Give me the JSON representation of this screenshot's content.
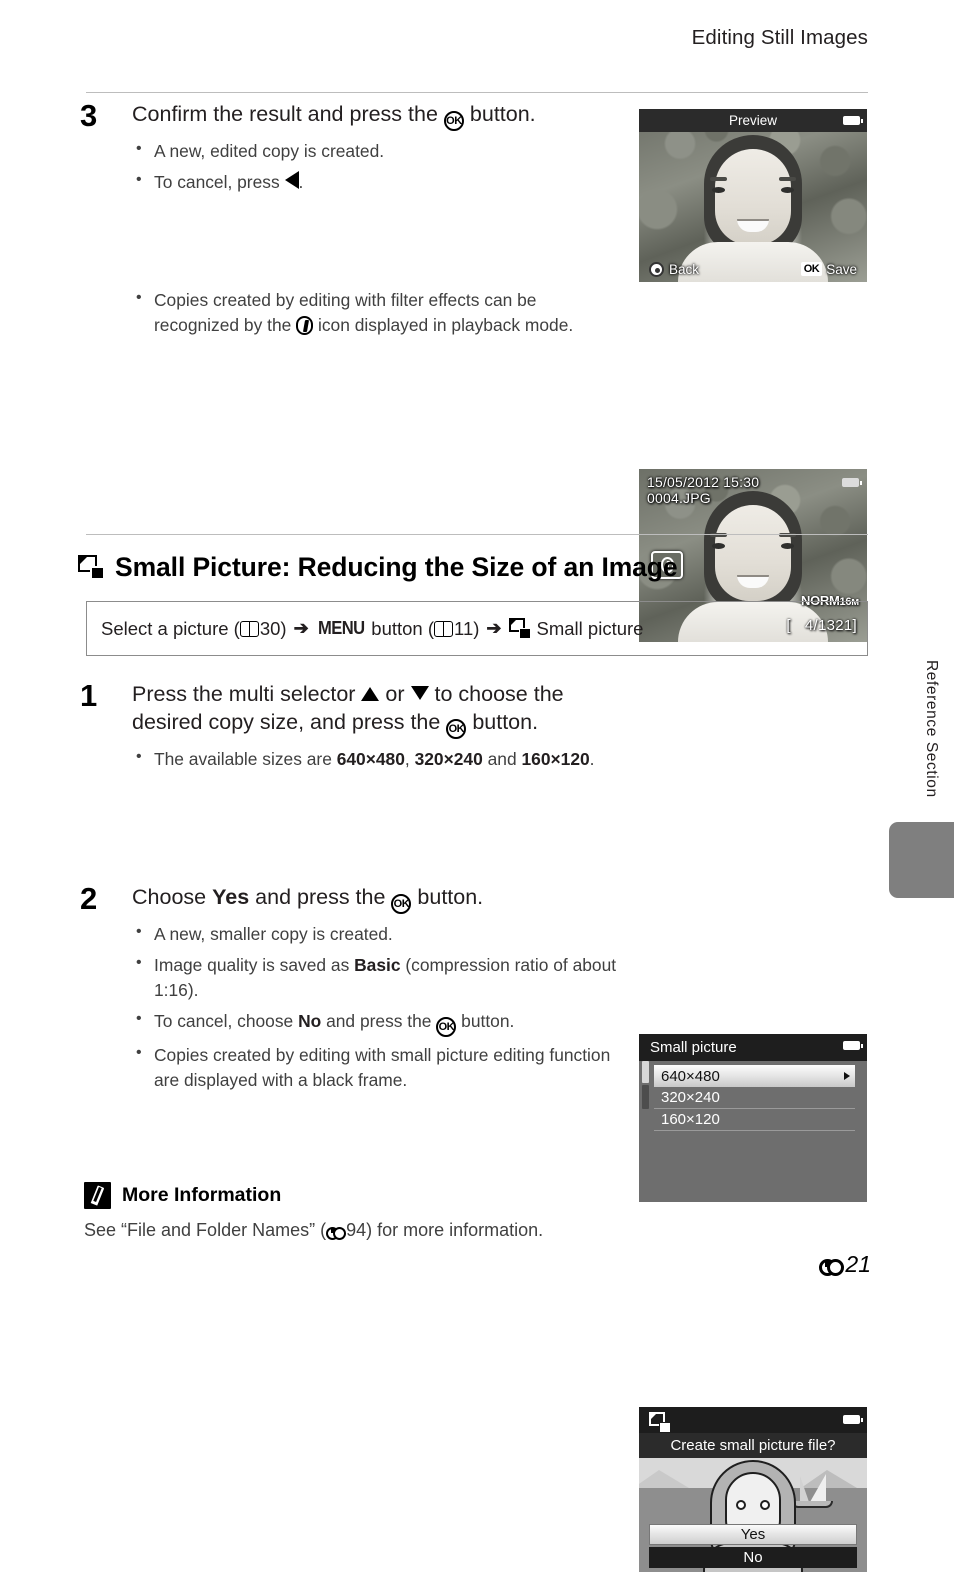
{
  "header": {
    "title": "Editing Still Images"
  },
  "step3": {
    "number": "3",
    "title_before": "Confirm the result and press the",
    "title_after": "button.",
    "bullets": [
      {
        "text": "A new, edited copy is created."
      },
      {
        "pre": "To cancel, press",
        "post": "."
      }
    ],
    "note_pre": "Copies created by editing with filter effects can be recognized by the",
    "note_post": "icon displayed in playback mode."
  },
  "preview_screen": {
    "title": "Preview",
    "back_label": "Back",
    "save_label": "Save",
    "ok_chip": "OK"
  },
  "playback_screen": {
    "datetime": "15/05/2012  15:30",
    "filename": "0004.JPG",
    "quality": "NORM",
    "image_size": "16м",
    "frame_count": "4/1321"
  },
  "section": {
    "title": "Small Picture: Reducing the Size of an Image",
    "nav_part1": "Select a picture (",
    "nav_ref1": "30",
    "nav_part2": ")",
    "nav_menu": "MENU",
    "nav_part3": "button (",
    "nav_ref2": "11",
    "nav_part4": ")",
    "nav_final": "Small picture",
    "arrow": "➔"
  },
  "step1": {
    "number": "1",
    "title_a": "Press the multi selector",
    "title_b": "or",
    "title_c": "to choose the desired copy size, and press the",
    "title_d": "button.",
    "bullet_pre": "The available sizes are",
    "size1": "640×480",
    "size_sep": ",",
    "size2": "320×240",
    "bullet_and": "and",
    "size3": "160×120",
    "bullet_end": "."
  },
  "menu_screen": {
    "title": "Small picture",
    "items": [
      {
        "label": "640×480",
        "selected": true
      },
      {
        "label": "320×240",
        "selected": false
      },
      {
        "label": "160×120",
        "selected": false
      }
    ]
  },
  "step2": {
    "number": "2",
    "title_a": "Choose",
    "title_yes": "Yes",
    "title_b": "and press the",
    "title_c": "button.",
    "bullets": [
      {
        "text": "A new, smaller copy is created."
      },
      {
        "pre": "Image quality is saved as",
        "bold": "Basic",
        "post": "(compression ratio of about 1:16)."
      },
      {
        "pre": "To cancel, choose",
        "bold": "No",
        "post": "and press the",
        "tail": "button."
      },
      {
        "text": "Copies created by editing with small picture editing function are displayed with a black frame."
      }
    ]
  },
  "confirm_screen": {
    "question": "Create small picture file?",
    "yes_label": "Yes",
    "no_label": "No"
  },
  "side": {
    "label": "Reference Section"
  },
  "more_information": {
    "title": "More Information",
    "body_pre": "See “File and Folder Names” (",
    "ref": "94",
    "body_post": ") for more information."
  },
  "footer": {
    "page": "21"
  },
  "colors": {
    "rule": "#bdbdbd",
    "tab_gray": "#7f7f7f",
    "text": "#231f20",
    "body_text": "#404040"
  }
}
